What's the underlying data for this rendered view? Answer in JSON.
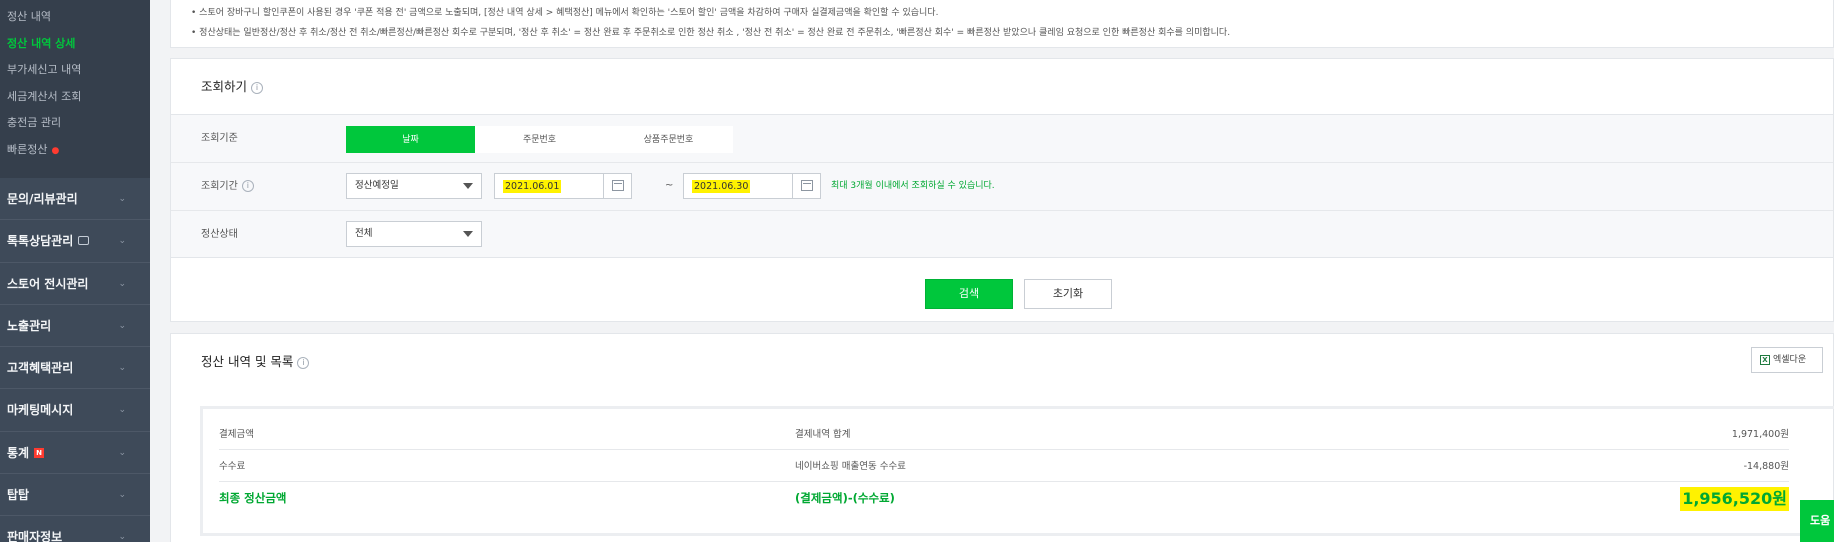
{
  "sidebar": {
    "sub_items": [
      {
        "label": "정산 내역",
        "active": false,
        "dot": false
      },
      {
        "label": "정산 내역 상세",
        "active": true,
        "dot": false
      },
      {
        "label": "부가세신고 내역",
        "active": false,
        "dot": false
      },
      {
        "label": "세금계산서 조회",
        "active": false,
        "dot": false
      },
      {
        "label": "충전금 관리",
        "active": false,
        "dot": false
      },
      {
        "label": "빠른정산",
        "active": false,
        "dot": true
      }
    ],
    "main_items": [
      {
        "label": "문의/리뷰관리"
      },
      {
        "label": "톡톡상담관리"
      },
      {
        "label": "스토어 전시관리"
      },
      {
        "label": "노출관리"
      },
      {
        "label": "고객혜택관리"
      },
      {
        "label": "마케팅메시지"
      },
      {
        "label": "통계"
      },
      {
        "label": "탑탑"
      },
      {
        "label": "판매자정보"
      }
    ],
    "stats_badge": "N"
  },
  "notice": {
    "lines": [
      "스토어 장바구니 할인쿠폰이 사용된 경우 '쿠폰 적용 전' 금액으로 노출되며, [정산 내역 상세 > 혜택정산] 메뉴에서 확인하는 '스토어 할인' 금액을 차감하여 구매자 실결제금액을 확인할 수 있습니다.",
      "정산상태는 일반정산/정산 후 취소/정산 전 취소/빠른정산/빠른정산 회수로 구분되며, '정산 후 취소' = 정산 완료 후 주문취소로 인한 정산 취소 , '정산 전 취소' = 정산 완료 전 주문취소, '빠른정산 회수' = 빠른정산 받았으나 클레임 요청으로 인한 빠른정산 회수를 의미합니다."
    ]
  },
  "search": {
    "title": "조회하기",
    "criteria_label": "조회기준",
    "criteria_options": [
      {
        "label": "날짜",
        "selected": true
      },
      {
        "label": "주문번호",
        "selected": false
      },
      {
        "label": "상품주문번호",
        "selected": false
      }
    ],
    "period_label": "조회기간",
    "period_type": "정산예정일",
    "start_date": "2021.06.01",
    "tilde": "~",
    "end_date": "2021.06.30",
    "period_hint": "최대 3개월 이내에서 조회하실 수 있습니다.",
    "status_label": "정산상태",
    "status_value": "전체",
    "search_button": "검색",
    "reset_button": "초기화"
  },
  "results": {
    "title": "정산 내역 및 목록",
    "excel_button": "엑셀다운",
    "excel_icon": "X",
    "rows": [
      {
        "label": "결제금액",
        "desc": "결제내역 합계",
        "value": "1,971,400원"
      },
      {
        "label": "수수료",
        "desc": "네이버쇼핑 매출연동 수수료",
        "value": "-14,880원"
      }
    ],
    "final": {
      "label": "최종 정산금액",
      "desc": "(결제금액)-(수수료)",
      "value": "1,956,520원"
    }
  },
  "help_button": "도움",
  "colors": {
    "accent": "#00c73c",
    "sidebar_bg": "#3e4a59",
    "highlight": "#fff200"
  }
}
